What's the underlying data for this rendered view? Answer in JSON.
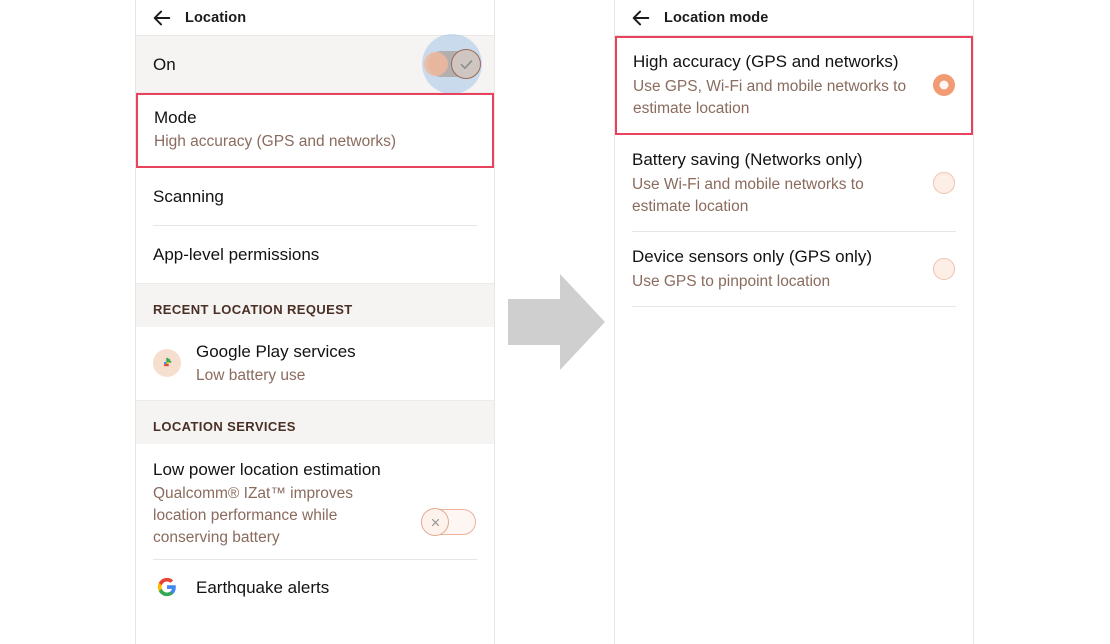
{
  "colors": {
    "highlight_border": "#e8425c",
    "accent_salmon": "#f29a72",
    "subtext_brown": "#8a6b5e",
    "ripple_blue": "#8fb6e8",
    "arrow_gray": "#cfcfcf"
  },
  "left_panel": {
    "appbar": {
      "back_icon": "back-arrow-icon",
      "title": "Location"
    },
    "status_row": {
      "label": "On",
      "toggle_state": "on",
      "toggle_icon": "check-icon"
    },
    "mode_row": {
      "title": "Mode",
      "subtitle": "High accuracy (GPS and networks)",
      "highlighted": true
    },
    "items": [
      {
        "title": "Scanning"
      },
      {
        "title": "App-level permissions"
      }
    ],
    "section_recent": {
      "header": "RECENT LOCATION REQUEST",
      "entry": {
        "icon": "google-play-services-icon",
        "title": "Google Play services",
        "subtitle": "Low battery use"
      }
    },
    "section_services": {
      "header": "LOCATION SERVICES",
      "low_power": {
        "title": "Low power location estimation",
        "subtitle": "Qualcomm® IZat™ improves location performance while conserving battery",
        "toggle_state": "off",
        "toggle_icon": "close-icon"
      },
      "earthquake": {
        "icon": "google-logo-icon",
        "title": "Earthquake alerts"
      }
    }
  },
  "arrow": {
    "icon": "right-arrow-icon"
  },
  "right_panel": {
    "appbar": {
      "back_icon": "back-arrow-icon",
      "title": "Location mode"
    },
    "options": [
      {
        "title": "High accuracy (GPS and networks)",
        "subtitle": "Use GPS, Wi-Fi and mobile networks to estimate location",
        "selected": true,
        "highlighted": true
      },
      {
        "title": "Battery saving (Networks only)",
        "subtitle": "Use Wi-Fi and mobile networks to estimate location",
        "selected": false,
        "highlighted": false
      },
      {
        "title": "Device sensors only (GPS only)",
        "subtitle": "Use GPS to pinpoint location",
        "selected": false,
        "highlighted": false
      }
    ]
  }
}
